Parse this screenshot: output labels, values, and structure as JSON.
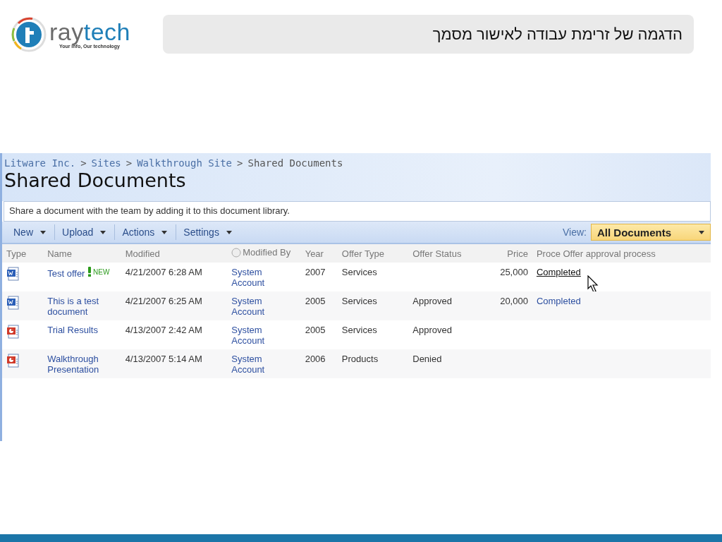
{
  "logo": {
    "wordmark": {
      "first": "ray",
      "second": "tech"
    },
    "tagline": "Your info, Our technology"
  },
  "slide_title": "הדגמה של זרימת עבודה לאישור מסמך",
  "breadcrumb": [
    {
      "kind": "link",
      "text": "Litware Inc."
    },
    {
      "kind": "separator",
      "text": ">"
    },
    {
      "kind": "link",
      "text": "Sites"
    },
    {
      "kind": "separator",
      "text": ">"
    },
    {
      "kind": "link",
      "text": "Walkthrough Site"
    },
    {
      "kind": "separator",
      "text": ">"
    },
    {
      "kind": "current",
      "text": "Shared Documents"
    }
  ],
  "page_title": "Shared Documents",
  "description": "Share a document with the team by adding it to this document library.",
  "toolbar": {
    "menus": [
      "New",
      "Upload",
      "Actions",
      "Settings"
    ],
    "view_label": "View:",
    "view_value": "All Documents"
  },
  "table": {
    "columns": [
      {
        "kind": "plain",
        "label": "Type"
      },
      {
        "kind": "plain",
        "label": "Name"
      },
      {
        "kind": "plain",
        "label": "Modified"
      },
      {
        "kind": "presence",
        "label": "Modified By"
      },
      {
        "kind": "plain",
        "label": "Year"
      },
      {
        "kind": "plain",
        "label": "Offer Type"
      },
      {
        "kind": "plain",
        "label": "Offer Status"
      },
      {
        "kind": "number",
        "label": "Price"
      },
      {
        "kind": "plain",
        "label": "Proce Offer approval process"
      }
    ],
    "rows": [
      {
        "kind": "word",
        "name": "Test offer",
        "is_new": true,
        "new_label": "NEW",
        "modified": "4/21/2007 6:28 AM",
        "modified_by": "System Account",
        "year": "2007",
        "offer_type": "Services",
        "price": "25,000",
        "workflow": {
          "text": "Completed",
          "hovered": true
        }
      },
      {
        "kind": "word",
        "name": "This is a test document",
        "is_new": false,
        "modified": "4/21/2007 6:25 AM",
        "modified_by": "System Account",
        "year": "2005",
        "offer_type": "Services",
        "offer_status": "Approved",
        "price": "20,000",
        "workflow": {
          "text": "Completed",
          "hovered": false
        }
      },
      {
        "kind": "presentation",
        "name": "Trial Results",
        "is_new": false,
        "modified": "4/13/2007 2:42 AM",
        "modified_by": "System Account",
        "year": "2005",
        "offer_type": "Services",
        "offer_status": "Approved"
      },
      {
        "kind": "presentation",
        "name": "Walkthrough Presentation",
        "is_new": false,
        "modified": "4/13/2007 5:14 AM",
        "modified_by": "System Account",
        "year": "2006",
        "offer_type": "Products",
        "offer_status": "Denied"
      }
    ]
  }
}
